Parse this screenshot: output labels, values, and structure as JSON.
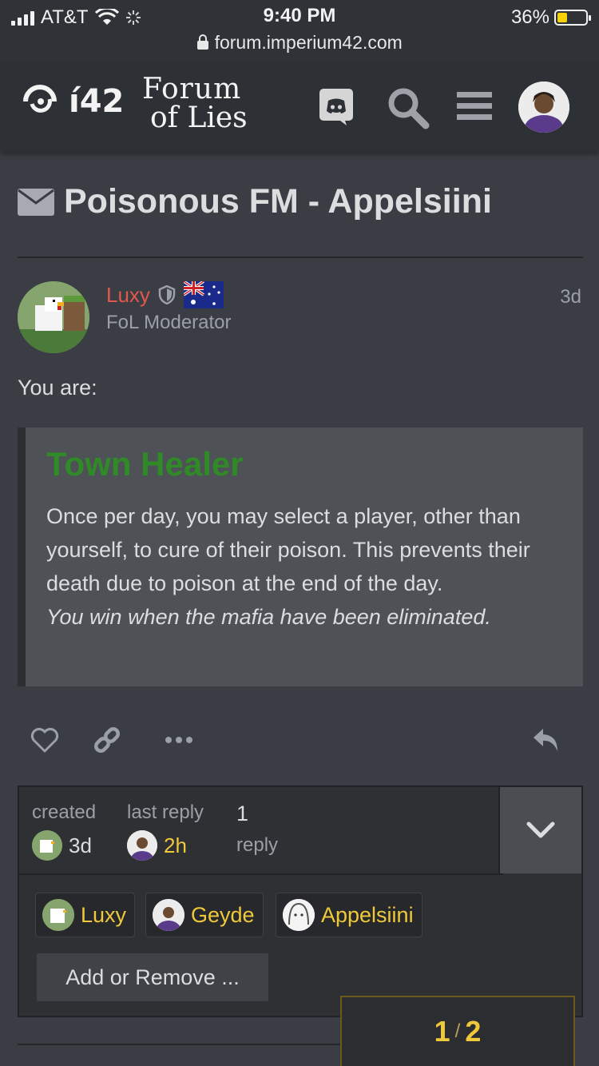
{
  "status_bar": {
    "carrier": "AT&T",
    "time": "9:40 PM",
    "battery_percent": "36%",
    "battery_level": 0.36,
    "url": "forum.imperium42.com"
  },
  "header": {
    "logo_i42": "í42",
    "logo_line1": "Forum",
    "logo_line2": "of Lies"
  },
  "topic": {
    "title": "Poisonous FM - Appelsiini"
  },
  "post": {
    "username": "Luxy",
    "role": "FoL Moderator",
    "age": "3d",
    "intro": "You are:",
    "quote_title": "Town Healer",
    "quote_body": "Once per day, you may select a player, other than yourself, to cure of their poison. This prevents their death due to poison at the end of the day.",
    "quote_win": "You win when the mafia have been eliminated."
  },
  "topic_map": {
    "created_label": "created",
    "created_value": "3d",
    "last_reply_label": "last reply",
    "last_reply_value": "2h",
    "replies_count": "1",
    "replies_label": "reply",
    "participants": [
      "Luxy",
      "Geyde",
      "Appelsiini"
    ],
    "add_remove_label": "Add or Remove ..."
  },
  "progress": {
    "current": "1",
    "total": "2"
  },
  "colors": {
    "accent_username": "#e0594c",
    "quote_title": "#2f8a27",
    "link_yellow": "#f0c93b"
  }
}
